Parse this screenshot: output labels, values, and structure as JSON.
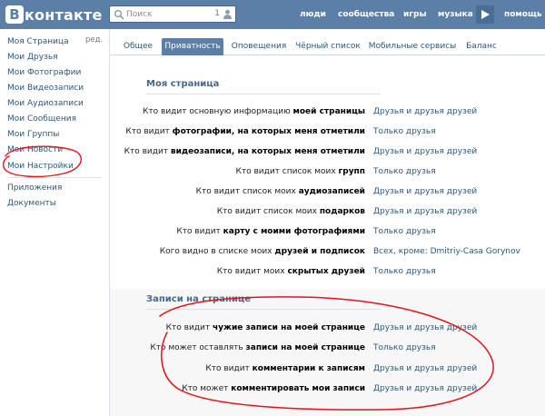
{
  "header": {
    "logo_badge": "B",
    "logo_text": "контакте",
    "search_placeholder": "Поиск",
    "search_count": "1",
    "nav": [
      "люди",
      "сообщества",
      "игры",
      "музыка",
      "помощь"
    ],
    "colors": {
      "bar": "#5b7fa6",
      "link": "#2b587a"
    }
  },
  "sidebar": {
    "items": [
      "Моя Страница",
      "Мои Друзья",
      "Мои Фотографии",
      "Мои Видеозаписи",
      "Мои Аудиозаписи",
      "Мои Сообщения",
      "Мои Группы",
      "Мои Новости",
      "Мои Настройки"
    ],
    "edit_label": "ред.",
    "extra": [
      "Приложения",
      "Документы"
    ]
  },
  "tabs": [
    "Общее",
    "Приватность",
    "Оповещения",
    "Чёрный список",
    "Мобильные сервисы",
    "Баланс"
  ],
  "active_tab": "Приватность",
  "sections": [
    {
      "title": "Моя страница",
      "rows": [
        {
          "pre": "Кто видит основную информацию ",
          "bold": "моей страницы",
          "value": "Друзья и друзья друзей"
        },
        {
          "pre": "Кто видит ",
          "bold": "фотографии, на которых меня отметили",
          "value": "Только друзья"
        },
        {
          "pre": "Кто видит ",
          "bold": "видеозаписи, на которых меня отметили",
          "value": "Друзья и друзья друзей"
        },
        {
          "pre": "Кто видит список моих ",
          "bold": "групп",
          "value": "Только друзья"
        },
        {
          "pre": "Кто видит список моих ",
          "bold": "аудиозаписей",
          "value": "Друзья и друзья друзей"
        },
        {
          "pre": "Кто видит список моих ",
          "bold": "подарков",
          "value": "Друзья и друзья друзей"
        },
        {
          "pre": "Кто видит ",
          "bold": "карту с моими фотографиями",
          "value": "Только друзья"
        },
        {
          "pre": "Кого видно в списке моих ",
          "bold": "друзей и подписок",
          "value": "Всех, кроме: Dmitriy-Casa Gorynov"
        },
        {
          "pre": "Кто видит моих ",
          "bold": "скрытых друзей",
          "value": "Только друзья"
        }
      ]
    },
    {
      "title": "Записи на странице",
      "rows": [
        {
          "pre": "Кто видит ",
          "bold": "чужие записи на моей странице",
          "value": "Друзья и друзья друзей"
        },
        {
          "pre": "Кто может оставлять ",
          "bold": "записи на моей странице",
          "value": "Только друзья"
        },
        {
          "pre": "Кто видит ",
          "bold": "комментарии к записям",
          "value": "Друзья и друзья друзей"
        },
        {
          "pre": "Кто может ",
          "bold": "комментировать мои записи",
          "value": "Друзья и друзья друзей"
        }
      ]
    }
  ]
}
